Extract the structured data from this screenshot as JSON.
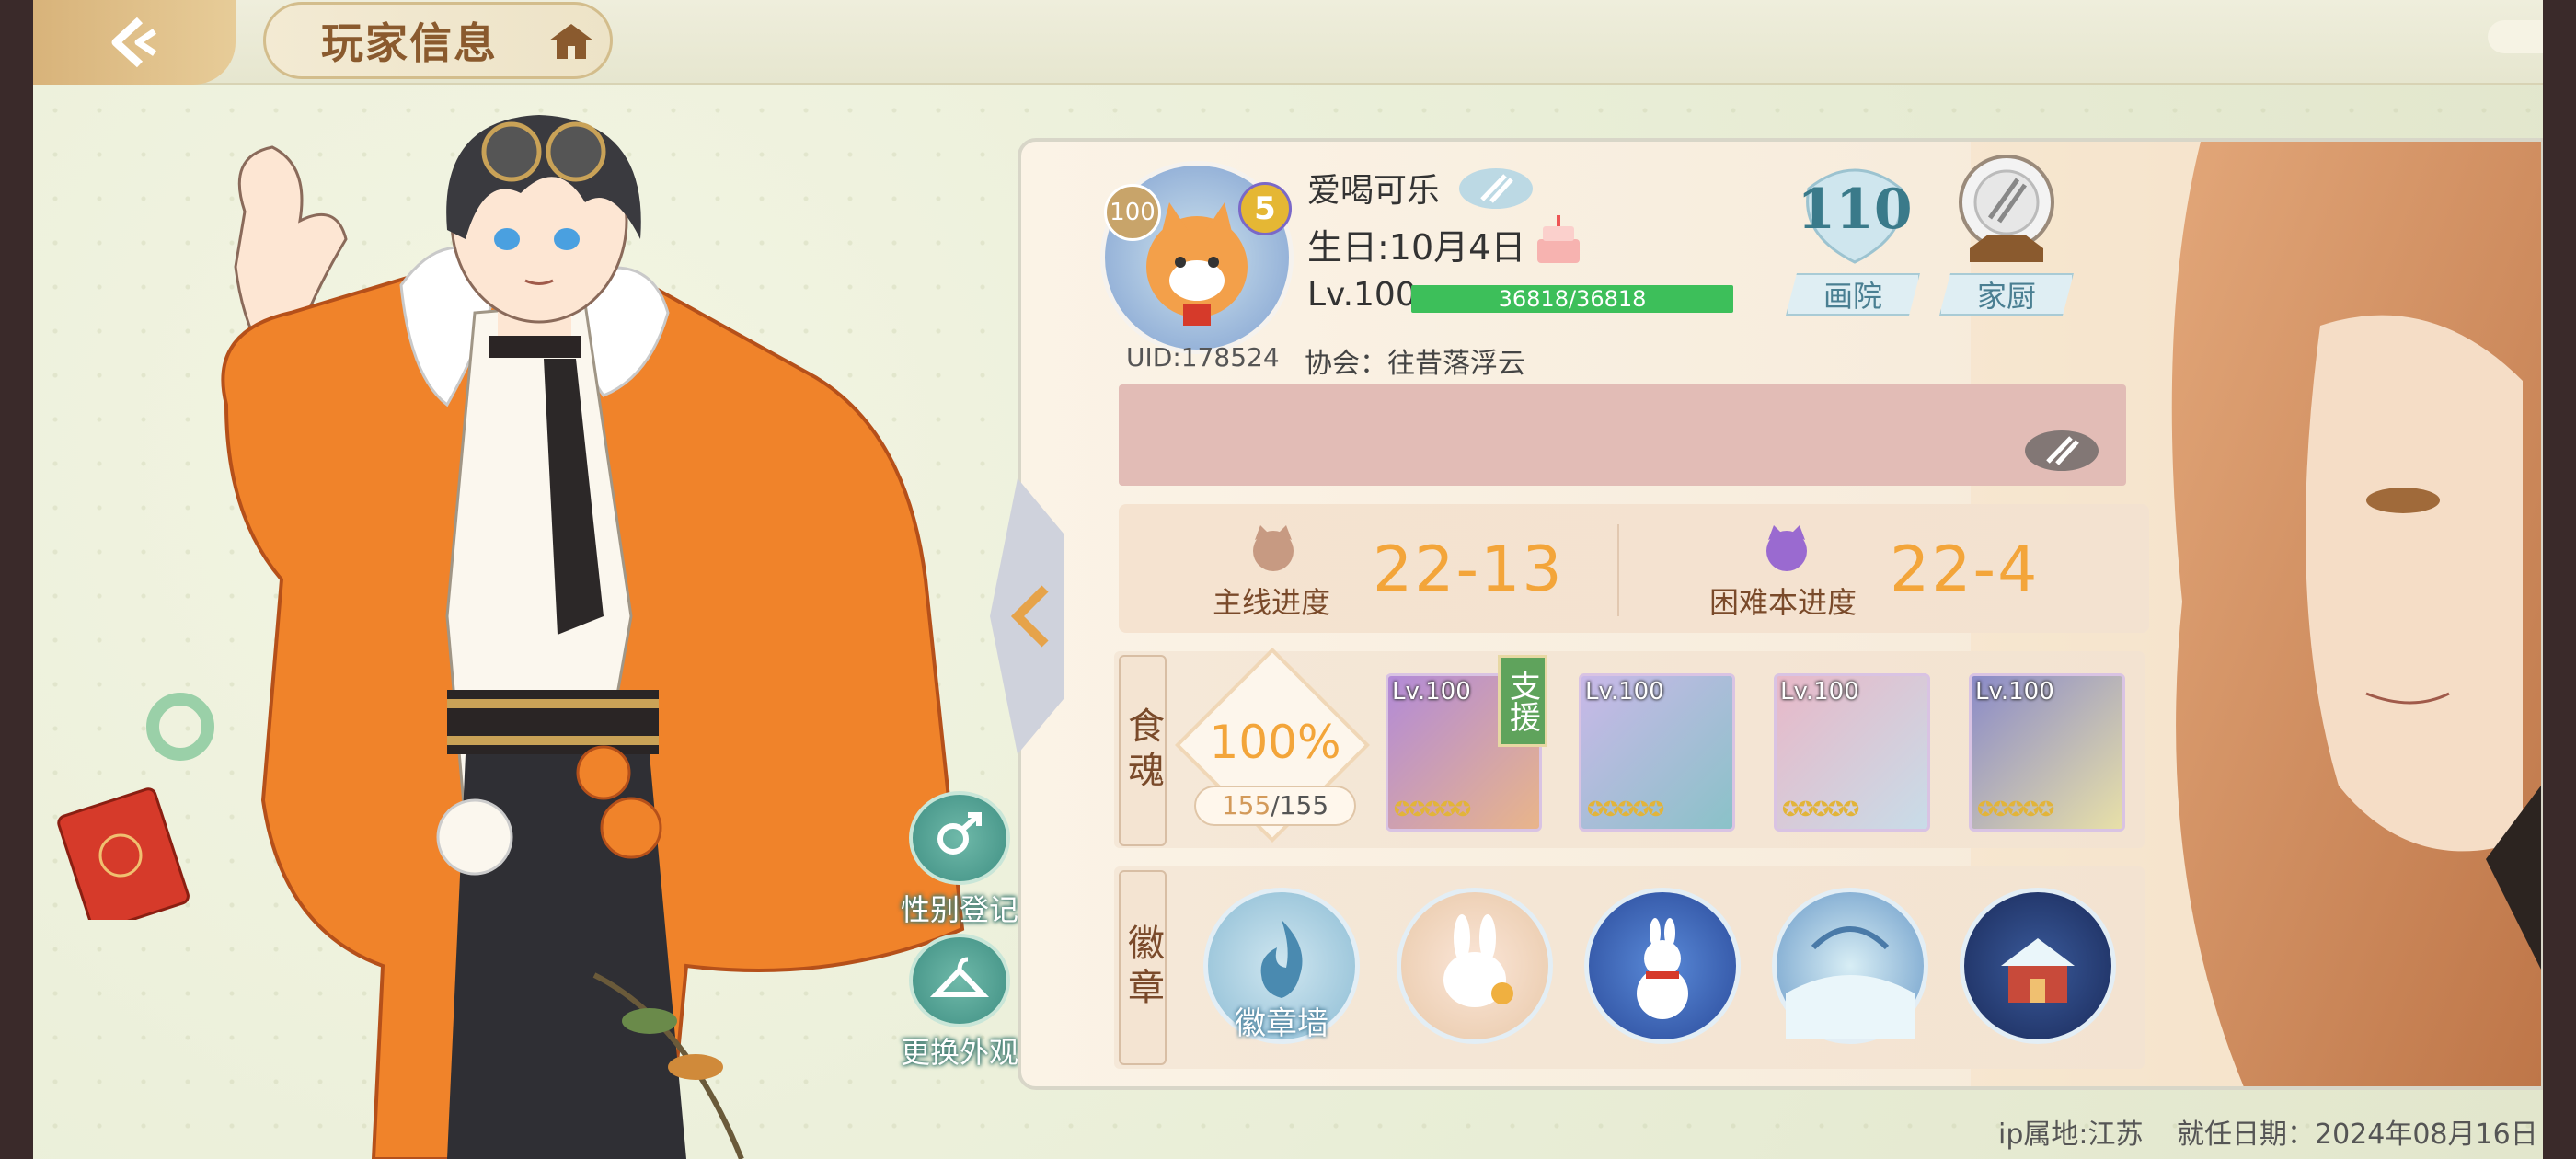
{
  "header": {
    "title": "玩家信息",
    "back_icon": "back-arrow-icon",
    "home_icon": "home-icon"
  },
  "player": {
    "name": "爱喝可乐",
    "birthday": "生日:10月4日",
    "level": "Lv.100",
    "exp": "36818/36818",
    "exp_fraction": 1.0,
    "uid": "UID:178524",
    "guild": "协会：往昔落浮云",
    "avatar_level": "100",
    "avatar_rank": "5"
  },
  "shortcuts": {
    "gallery_count": "110",
    "gallery_label": "画院",
    "kitchen_label": "家厨"
  },
  "side_buttons": {
    "gender_label": "性别登记",
    "outfit_label": "更换外观"
  },
  "progress": {
    "main_label": "主线进度",
    "main_value": "22-13",
    "hard_label": "困难本进度",
    "hard_value": "22-4"
  },
  "souls": {
    "section_label": "食魂",
    "percent": "100%",
    "owned": "155",
    "total": "/155",
    "support_tag": "支援",
    "cards": [
      {
        "level": "Lv.100",
        "stars": "✪✪✪✪✪"
      },
      {
        "level": "Lv.100",
        "stars": "✪✪✪✪✪"
      },
      {
        "level": "Lv.100",
        "stars": "✪✪✪✪✪"
      },
      {
        "level": "Lv.100",
        "stars": "✪✪✪✪✪"
      }
    ]
  },
  "badges": {
    "section_label": "徽章",
    "wall_label": "徽章墙"
  },
  "footer": {
    "ip": "ip属地:江苏",
    "date": "就任日期：2024年08月16日"
  },
  "colors": {
    "accent_orange": "#f3a53a",
    "exp_green": "#3dbf5a",
    "title_brown": "#8a5a2e"
  }
}
